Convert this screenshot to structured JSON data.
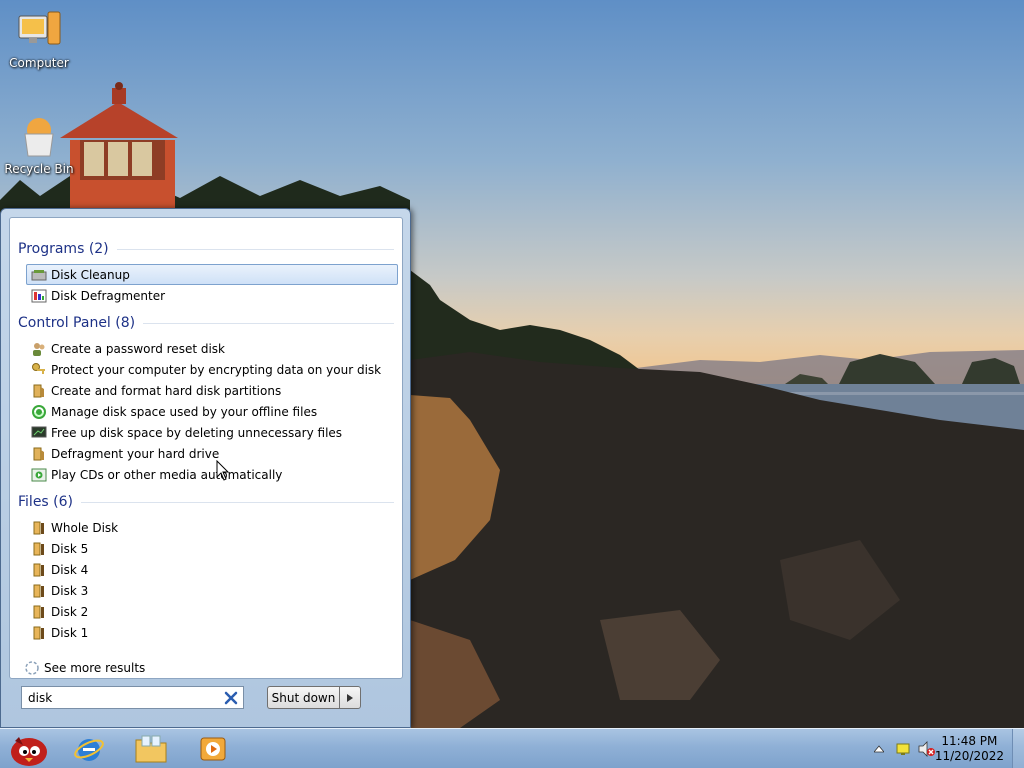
{
  "desktop": {
    "icons": [
      {
        "label": "Computer",
        "icon": "computer-icon"
      },
      {
        "label": "Recycle Bin",
        "icon": "recycle-bin-icon"
      }
    ]
  },
  "start_menu": {
    "groups": {
      "programs": {
        "header": "Programs (2)",
        "items": [
          {
            "label": "Disk Cleanup",
            "icon": "disk-cleanup-icon",
            "selected": true
          },
          {
            "label": "Disk Defragmenter",
            "icon": "disk-defragmenter-icon"
          }
        ]
      },
      "control_panel": {
        "header": "Control Panel (8)",
        "items": [
          {
            "label": "Create a password reset disk",
            "icon": "users-icon"
          },
          {
            "label": "Protect your computer by encrypting data on your disk",
            "icon": "keys-icon"
          },
          {
            "label": "Create and format hard disk partitions",
            "icon": "admin-tools-icon"
          },
          {
            "label": "Manage disk space used by your offline files",
            "icon": "sync-icon"
          },
          {
            "label": "Free up disk space by deleting unnecessary files",
            "icon": "system-icon"
          },
          {
            "label": "Defragment your hard drive",
            "icon": "admin-tools-icon"
          },
          {
            "label": "Play CDs or other media automatically",
            "icon": "autoplay-icon"
          }
        ]
      },
      "files": {
        "header": "Files (6)",
        "items": [
          {
            "label": "Whole Disk",
            "icon": "file-icon"
          },
          {
            "label": "Disk 5",
            "icon": "file-icon"
          },
          {
            "label": "Disk 4",
            "icon": "file-icon"
          },
          {
            "label": "Disk 3",
            "icon": "file-icon"
          },
          {
            "label": "Disk 2",
            "icon": "file-icon"
          },
          {
            "label": "Disk 1",
            "icon": "file-icon"
          }
        ]
      }
    },
    "see_more": "See more results",
    "search": {
      "value": "disk"
    },
    "shutdown_label": "Shut down"
  },
  "taskbar": {
    "pinned": [
      "start-orb-icon",
      "internet-explorer-icon",
      "windows-explorer-icon",
      "media-player-icon"
    ],
    "clock": {
      "time": "11:48 PM",
      "date": "11/20/2022"
    }
  },
  "colors": {
    "group_header": "#1e3287",
    "selection_border": "#7da2ce",
    "taskbar": "#8fb0d6"
  }
}
